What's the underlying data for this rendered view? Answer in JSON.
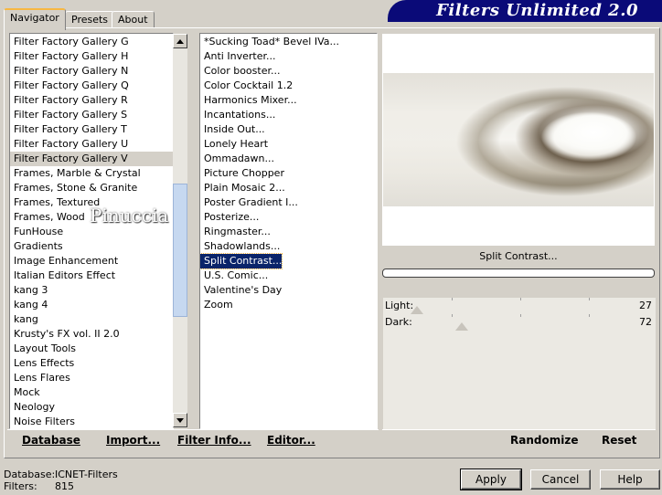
{
  "tabs": [
    {
      "label": "Navigator"
    },
    {
      "label": "Presets"
    },
    {
      "label": "About"
    }
  ],
  "banner": {
    "title": "Filters Unlimited 2.0"
  },
  "categories": [
    "Filter Factory Gallery G",
    "Filter Factory Gallery H",
    "Filter Factory Gallery N",
    "Filter Factory Gallery Q",
    "Filter Factory Gallery R",
    "Filter Factory Gallery S",
    "Filter Factory Gallery T",
    "Filter Factory Gallery U",
    "Filter Factory Gallery V",
    "Frames, Marble & Crystal",
    "Frames, Stone & Granite",
    "Frames, Textured",
    "Frames, Wood",
    "FunHouse",
    "Gradients",
    "Image Enhancement",
    "Italian Editors Effect",
    "kang 3",
    "kang 4",
    "kang",
    "Krusty's FX vol. II 2.0",
    "Layout Tools",
    "Lens Effects",
    "Lens Flares",
    "Mock",
    "Neology",
    "Noise Filters"
  ],
  "selected_category": "Filter Factory Gallery V",
  "filters": [
    "*Sucking Toad*  Bevel IVa...",
    "Anti Inverter...",
    "Color booster...",
    "Color Cocktail 1.2",
    "Harmonics Mixer...",
    "Incantations...",
    "Inside Out...",
    "Lonely Heart",
    "Ommadawn...",
    "Picture Chopper",
    "Plain Mosaic 2...",
    "Poster Gradient I...",
    "Posterize...",
    "Ringmaster...",
    "Shadowlands...",
    "Split Contrast...",
    "U.S. Comic...",
    "Valentine's Day",
    "Zoom"
  ],
  "selected_filter": "Split Contrast...",
  "watermark": "Pinuccia",
  "preview": {
    "filter_name": "Split Contrast..."
  },
  "params": [
    {
      "label": "Light:",
      "value": "27",
      "fraction": 0.27
    },
    {
      "label": "Dark:",
      "value": "72",
      "fraction": 0.72
    }
  ],
  "actions": {
    "database": "Database",
    "import": "Import...",
    "filter_info": "Filter Info...",
    "editor": "Editor...",
    "randomize": "Randomize",
    "reset": "Reset"
  },
  "status": {
    "database_label": "Database:",
    "database_value": "ICNET-Filters",
    "filters_label": "Filters:",
    "filters_value": "815"
  },
  "buttons": {
    "apply": "Apply",
    "cancel": "Cancel",
    "help": "Help"
  }
}
